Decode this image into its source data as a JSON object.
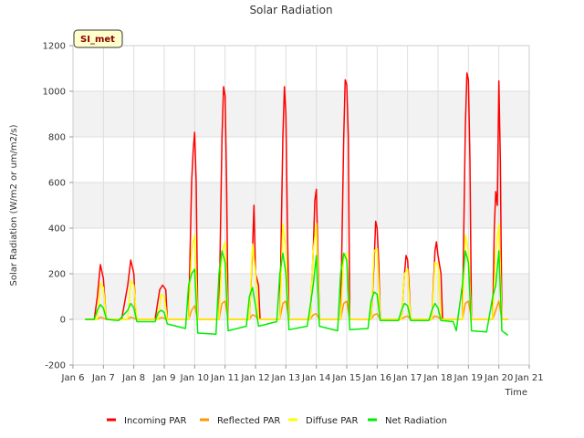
{
  "chart_data": {
    "type": "line",
    "title": "Solar Radiation",
    "xlabel": "Time",
    "ylabel": "Solar Radiation (W/m2 or um/m2/s)",
    "badge": "SI_met",
    "xlim": [
      6,
      21
    ],
    "ylim": [
      -200,
      1200
    ],
    "x_ticks": [
      {
        "value": 6,
        "label": "Jan 6"
      },
      {
        "value": 7,
        "label": "Jan 7"
      },
      {
        "value": 8,
        "label": "Jan 8"
      },
      {
        "value": 9,
        "label": "Jan 9"
      },
      {
        "value": 10,
        "label": "Jan 10"
      },
      {
        "value": 11,
        "label": "Jan 11"
      },
      {
        "value": 12,
        "label": "Jan 12"
      },
      {
        "value": 13,
        "label": "Jan 13"
      },
      {
        "value": 14,
        "label": "Jan 14"
      },
      {
        "value": 15,
        "label": "Jan 15"
      },
      {
        "value": 16,
        "label": "Jan 16"
      },
      {
        "value": 17,
        "label": "Jan 17"
      },
      {
        "value": 18,
        "label": "Jan 18"
      },
      {
        "value": 19,
        "label": "Jan 19"
      },
      {
        "value": 20,
        "label": "Jan 20"
      },
      {
        "value": 21,
        "label": "Jan 21"
      }
    ],
    "y_ticks": [
      -200,
      0,
      200,
      400,
      600,
      800,
      1000,
      1200
    ],
    "grid": true,
    "legend_position": "bottom",
    "series": [
      {
        "name": "Incoming PAR",
        "color": "#ff0000",
        "points": [
          [
            6.4,
            0
          ],
          [
            6.7,
            0
          ],
          [
            6.8,
            100
          ],
          [
            6.9,
            240
          ],
          [
            7.0,
            180
          ],
          [
            7.05,
            80
          ],
          [
            7.1,
            0
          ],
          [
            7.6,
            0
          ],
          [
            7.8,
            150
          ],
          [
            7.9,
            260
          ],
          [
            8.0,
            200
          ],
          [
            8.05,
            60
          ],
          [
            8.1,
            0
          ],
          [
            8.7,
            0
          ],
          [
            8.85,
            130
          ],
          [
            8.95,
            150
          ],
          [
            9.05,
            130
          ],
          [
            9.1,
            0
          ],
          [
            9.8,
            0
          ],
          [
            9.9,
            600
          ],
          [
            9.95,
            740
          ],
          [
            10.0,
            820
          ],
          [
            10.05,
            600
          ],
          [
            10.1,
            0
          ],
          [
            10.8,
            0
          ],
          [
            10.9,
            800
          ],
          [
            10.95,
            1020
          ],
          [
            11.0,
            980
          ],
          [
            11.05,
            600
          ],
          [
            11.1,
            0
          ],
          [
            11.8,
            0
          ],
          [
            11.9,
            300
          ],
          [
            11.95,
            500
          ],
          [
            12.0,
            200
          ],
          [
            12.1,
            150
          ],
          [
            12.15,
            0
          ],
          [
            12.8,
            0
          ],
          [
            12.85,
            400
          ],
          [
            12.9,
            800
          ],
          [
            12.95,
            1020
          ],
          [
            13.0,
            900
          ],
          [
            13.05,
            400
          ],
          [
            13.1,
            0
          ],
          [
            13.8,
            0
          ],
          [
            13.9,
            300
          ],
          [
            13.95,
            520
          ],
          [
            14.0,
            570
          ],
          [
            14.05,
            300
          ],
          [
            14.1,
            0
          ],
          [
            14.8,
            0
          ],
          [
            14.9,
            800
          ],
          [
            14.95,
            1050
          ],
          [
            15.0,
            1030
          ],
          [
            15.05,
            800
          ],
          [
            15.1,
            0
          ],
          [
            15.8,
            0
          ],
          [
            15.9,
            250
          ],
          [
            15.95,
            430
          ],
          [
            16.0,
            400
          ],
          [
            16.05,
            250
          ],
          [
            16.1,
            0
          ],
          [
            16.8,
            0
          ],
          [
            16.9,
            200
          ],
          [
            16.95,
            280
          ],
          [
            17.0,
            260
          ],
          [
            17.05,
            150
          ],
          [
            17.1,
            0
          ],
          [
            17.8,
            0
          ],
          [
            17.9,
            300
          ],
          [
            17.95,
            340
          ],
          [
            18.0,
            280
          ],
          [
            18.1,
            200
          ],
          [
            18.15,
            0
          ],
          [
            18.8,
            0
          ],
          [
            18.85,
            400
          ],
          [
            18.9,
            850
          ],
          [
            18.95,
            1080
          ],
          [
            19.0,
            1050
          ],
          [
            19.05,
            700
          ],
          [
            19.1,
            0
          ],
          [
            19.8,
            0
          ],
          [
            19.85,
            400
          ],
          [
            19.9,
            560
          ],
          [
            19.95,
            500
          ],
          [
            20.0,
            1045
          ],
          [
            20.05,
            700
          ],
          [
            20.1,
            0
          ],
          [
            20.3,
            0
          ]
        ]
      },
      {
        "name": "Reflected PAR",
        "color": "#ff9900",
        "points": [
          [
            6.4,
            0
          ],
          [
            6.8,
            0
          ],
          [
            6.9,
            10
          ],
          [
            7.0,
            5
          ],
          [
            7.1,
            0
          ],
          [
            7.8,
            0
          ],
          [
            7.9,
            10
          ],
          [
            8.0,
            5
          ],
          [
            8.1,
            0
          ],
          [
            8.8,
            0
          ],
          [
            8.9,
            8
          ],
          [
            9.0,
            5
          ],
          [
            9.1,
            0
          ],
          [
            9.8,
            0
          ],
          [
            9.9,
            40
          ],
          [
            10.0,
            60
          ],
          [
            10.1,
            0
          ],
          [
            10.8,
            0
          ],
          [
            10.9,
            70
          ],
          [
            11.0,
            80
          ],
          [
            11.1,
            0
          ],
          [
            11.8,
            0
          ],
          [
            11.9,
            20
          ],
          [
            12.0,
            15
          ],
          [
            12.1,
            0
          ],
          [
            12.8,
            0
          ],
          [
            12.9,
            70
          ],
          [
            13.0,
            80
          ],
          [
            13.1,
            0
          ],
          [
            13.8,
            0
          ],
          [
            13.9,
            20
          ],
          [
            14.0,
            25
          ],
          [
            14.1,
            0
          ],
          [
            14.8,
            0
          ],
          [
            14.9,
            70
          ],
          [
            15.0,
            80
          ],
          [
            15.1,
            0
          ],
          [
            15.8,
            0
          ],
          [
            15.9,
            20
          ],
          [
            16.0,
            25
          ],
          [
            16.1,
            0
          ],
          [
            16.8,
            0
          ],
          [
            16.9,
            10
          ],
          [
            17.0,
            15
          ],
          [
            17.1,
            0
          ],
          [
            17.8,
            0
          ],
          [
            17.9,
            15
          ],
          [
            18.0,
            10
          ],
          [
            18.1,
            0
          ],
          [
            18.8,
            0
          ],
          [
            18.9,
            70
          ],
          [
            19.0,
            80
          ],
          [
            19.1,
            0
          ],
          [
            19.8,
            0
          ],
          [
            19.9,
            40
          ],
          [
            20.0,
            80
          ],
          [
            20.1,
            0
          ],
          [
            20.3,
            0
          ]
        ]
      },
      {
        "name": "Diffuse PAR",
        "color": "#ffff00",
        "points": [
          [
            6.4,
            0
          ],
          [
            6.8,
            0
          ],
          [
            6.9,
            160
          ],
          [
            7.0,
            140
          ],
          [
            7.1,
            0
          ],
          [
            7.8,
            0
          ],
          [
            7.9,
            170
          ],
          [
            8.0,
            150
          ],
          [
            8.1,
            0
          ],
          [
            8.8,
            0
          ],
          [
            8.9,
            110
          ],
          [
            9.0,
            100
          ],
          [
            9.1,
            0
          ],
          [
            9.8,
            0
          ],
          [
            9.9,
            300
          ],
          [
            10.0,
            370
          ],
          [
            10.1,
            0
          ],
          [
            10.8,
            0
          ],
          [
            10.9,
            300
          ],
          [
            11.0,
            340
          ],
          [
            11.1,
            0
          ],
          [
            11.8,
            0
          ],
          [
            11.9,
            330
          ],
          [
            12.0,
            200
          ],
          [
            12.1,
            0
          ],
          [
            12.8,
            0
          ],
          [
            12.9,
            420
          ],
          [
            13.0,
            300
          ],
          [
            13.1,
            0
          ],
          [
            13.8,
            0
          ],
          [
            13.9,
            300
          ],
          [
            14.0,
            420
          ],
          [
            14.1,
            0
          ],
          [
            14.8,
            0
          ],
          [
            14.9,
            280
          ],
          [
            15.0,
            290
          ],
          [
            15.1,
            0
          ],
          [
            15.8,
            0
          ],
          [
            15.9,
            300
          ],
          [
            16.0,
            310
          ],
          [
            16.1,
            0
          ],
          [
            16.8,
            0
          ],
          [
            16.9,
            200
          ],
          [
            17.0,
            220
          ],
          [
            17.1,
            0
          ],
          [
            17.8,
            0
          ],
          [
            17.9,
            250
          ],
          [
            18.0,
            240
          ],
          [
            18.1,
            0
          ],
          [
            18.8,
            0
          ],
          [
            18.9,
            370
          ],
          [
            19.0,
            300
          ],
          [
            19.1,
            0
          ],
          [
            19.8,
            0
          ],
          [
            19.9,
            300
          ],
          [
            20.0,
            420
          ],
          [
            20.1,
            0
          ],
          [
            20.3,
            0
          ]
        ]
      },
      {
        "name": "Net Radiation",
        "color": "#00ee00",
        "points": [
          [
            6.4,
            0
          ],
          [
            6.7,
            0
          ],
          [
            6.8,
            40
          ],
          [
            6.9,
            65
          ],
          [
            7.0,
            50
          ],
          [
            7.1,
            0
          ],
          [
            7.5,
            -5
          ],
          [
            7.8,
            40
          ],
          [
            7.9,
            70
          ],
          [
            8.0,
            50
          ],
          [
            8.1,
            -10
          ],
          [
            8.7,
            -10
          ],
          [
            8.8,
            30
          ],
          [
            8.9,
            40
          ],
          [
            9.0,
            30
          ],
          [
            9.1,
            -20
          ],
          [
            9.7,
            -40
          ],
          [
            9.8,
            150
          ],
          [
            9.9,
            200
          ],
          [
            10.0,
            220
          ],
          [
            10.1,
            -60
          ],
          [
            10.7,
            -65
          ],
          [
            10.8,
            200
          ],
          [
            10.9,
            300
          ],
          [
            11.0,
            250
          ],
          [
            11.1,
            -50
          ],
          [
            11.7,
            -30
          ],
          [
            11.8,
            100
          ],
          [
            11.9,
            140
          ],
          [
            12.0,
            60
          ],
          [
            12.1,
            -30
          ],
          [
            12.7,
            -10
          ],
          [
            12.8,
            200
          ],
          [
            12.9,
            290
          ],
          [
            13.0,
            200
          ],
          [
            13.1,
            -45
          ],
          [
            13.7,
            -30
          ],
          [
            13.8,
            60
          ],
          [
            13.9,
            150
          ],
          [
            14.0,
            280
          ],
          [
            14.1,
            -30
          ],
          [
            14.7,
            -50
          ],
          [
            14.8,
            200
          ],
          [
            14.9,
            290
          ],
          [
            15.0,
            260
          ],
          [
            15.1,
            -45
          ],
          [
            15.7,
            -40
          ],
          [
            15.8,
            80
          ],
          [
            15.9,
            120
          ],
          [
            16.0,
            110
          ],
          [
            16.1,
            -5
          ],
          [
            16.7,
            -5
          ],
          [
            16.8,
            40
          ],
          [
            16.9,
            70
          ],
          [
            17.0,
            60
          ],
          [
            17.1,
            -5
          ],
          [
            17.7,
            -5
          ],
          [
            17.8,
            40
          ],
          [
            17.9,
            70
          ],
          [
            18.0,
            50
          ],
          [
            18.1,
            -5
          ],
          [
            18.5,
            -10
          ],
          [
            18.6,
            -50
          ],
          [
            18.8,
            150
          ],
          [
            18.9,
            300
          ],
          [
            19.0,
            250
          ],
          [
            19.1,
            -50
          ],
          [
            19.6,
            -55
          ],
          [
            19.8,
            100
          ],
          [
            19.9,
            150
          ],
          [
            20.0,
            300
          ],
          [
            20.1,
            -50
          ],
          [
            20.3,
            -70
          ]
        ]
      }
    ]
  }
}
